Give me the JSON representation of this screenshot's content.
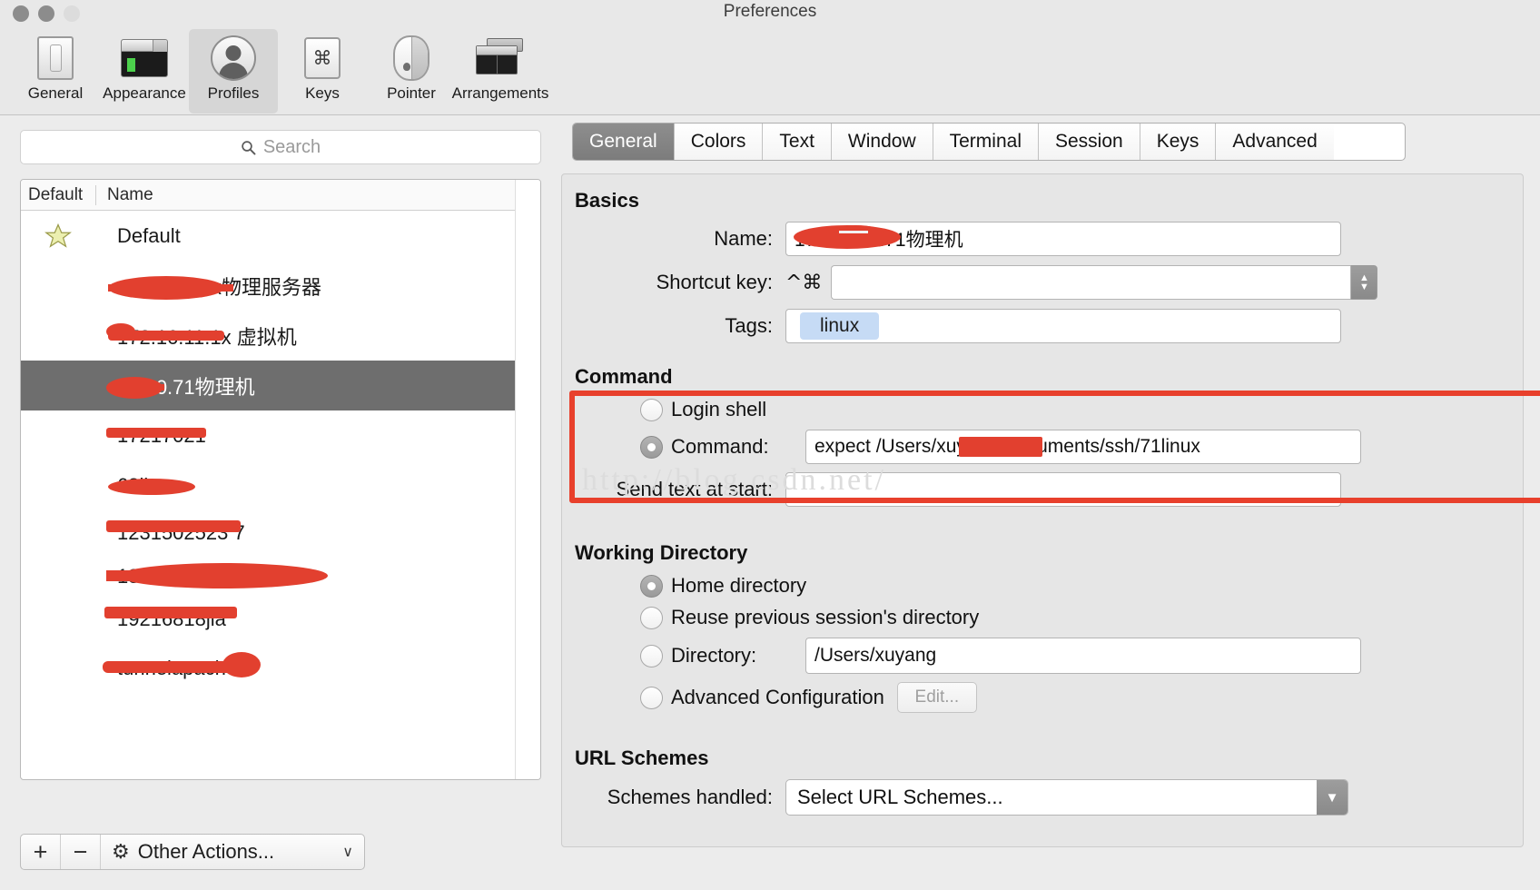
{
  "window": {
    "title": "Preferences"
  },
  "toolbar": {
    "items": [
      {
        "label": "General",
        "icon": "general-icon"
      },
      {
        "label": "Appearance",
        "icon": "appearance-icon"
      },
      {
        "label": "Profiles",
        "icon": "profiles-icon"
      },
      {
        "label": "Keys",
        "icon": "keys-icon",
        "glyph": "⌘"
      },
      {
        "label": "Pointer",
        "icon": "pointer-icon"
      },
      {
        "label": "Arrangements",
        "icon": "arrangements-icon"
      }
    ],
    "active": "Profiles"
  },
  "sidebar": {
    "search": {
      "placeholder": "Search",
      "value": ""
    },
    "columns": {
      "default": "Default",
      "name": "Name"
    },
    "profiles": [
      {
        "name": "Default",
        "is_default": true,
        "selected": false,
        "redacted": false
      },
      {
        "name": "172.16.10.х物理服务器",
        "is_default": false,
        "selected": false,
        "redacted": true
      },
      {
        "name": "172.16.11.1х 虚拟机",
        "is_default": false,
        "selected": false,
        "redacted": true
      },
      {
        "name": "10.10.71物理机",
        "is_default": false,
        "selected": true,
        "redacted": true
      },
      {
        "name": "17217021",
        "is_default": false,
        "selected": false,
        "redacted": true
      },
      {
        "name": "68linux",
        "is_default": false,
        "selected": false,
        "redacted": true
      },
      {
        "name": "1231502523 7",
        "is_default": false,
        "selected": false,
        "redacted": true
      },
      {
        "name": "182 ... aliyun",
        "is_default": false,
        "selected": false,
        "redacted": true
      },
      {
        "name": "19216818jia",
        "is_default": false,
        "selected": false,
        "redacted": true
      },
      {
        "name": "tunnelapache",
        "is_default": false,
        "selected": false,
        "redacted": true
      }
    ],
    "bottom_bar": {
      "add_label": "+",
      "remove_label": "−",
      "other_actions_label": "Other Actions...",
      "gear_glyph": "⚙",
      "chevron_glyph": "∨"
    }
  },
  "tabs": [
    {
      "label": "General",
      "active": true
    },
    {
      "label": "Colors",
      "active": false
    },
    {
      "label": "Text",
      "active": false
    },
    {
      "label": "Window",
      "active": false
    },
    {
      "label": "Terminal",
      "active": false
    },
    {
      "label": "Session",
      "active": false
    },
    {
      "label": "Keys",
      "active": false
    },
    {
      "label": "Advanced",
      "active": false
    }
  ],
  "general_tab": {
    "basics": {
      "heading": "Basics",
      "name_label": "Name:",
      "name_value": "172.16.10.71物理机",
      "shortcut_label": "Shortcut key:",
      "shortcut_modifiers": "^⌘",
      "shortcut_value": "",
      "tags_label": "Tags:",
      "tags": [
        "linux"
      ]
    },
    "command": {
      "heading": "Command",
      "login_shell_label": "Login shell",
      "login_shell_selected": false,
      "command_label": "Command:",
      "command_selected": true,
      "command_value": "expect /Users/xuyang/Documents/ssh/71linux",
      "send_text_label": "Send text at start:",
      "send_text_value": "",
      "highlight_color": "#e8402c",
      "watermark": "http://blog.csdn.net/"
    },
    "working_directory": {
      "heading": "Working Directory",
      "options": [
        {
          "label": "Home directory",
          "selected": true
        },
        {
          "label": "Reuse previous session's directory",
          "selected": false
        },
        {
          "label": "Directory:",
          "selected": false
        },
        {
          "label": "Advanced Configuration",
          "selected": false
        }
      ],
      "directory_value": "/Users/xuyang",
      "edit_button_label": "Edit..."
    },
    "url_schemes": {
      "heading": "URL Schemes",
      "schemes_label": "Schemes handled:",
      "schemes_value": "Select URL Schemes..."
    }
  }
}
